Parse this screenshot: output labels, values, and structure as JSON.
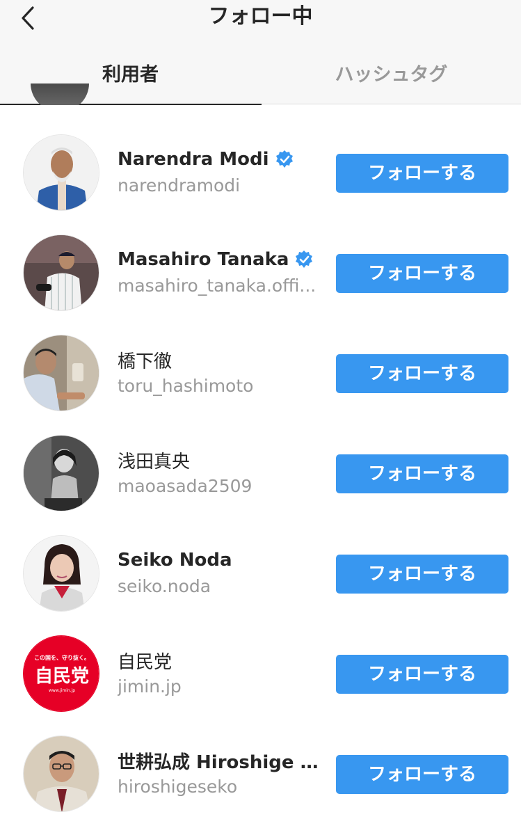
{
  "header": {
    "title": "フォロー中",
    "back_icon": "chevron-left-icon"
  },
  "tabs": [
    {
      "label": "利用者",
      "active": true
    },
    {
      "label": "ハッシュタグ",
      "active": false
    }
  ],
  "follow_label": "フォローする",
  "accounts": [
    {
      "name": "Narendra Modi",
      "handle": "narendramodi",
      "verified": true,
      "avatar": "narendra-modi-avatar"
    },
    {
      "name": "Masahiro Tanaka",
      "handle": "masahiro_tanaka.offi...",
      "verified": true,
      "avatar": "masahiro-tanaka-avatar"
    },
    {
      "name": "橋下徹",
      "handle": "toru_hashimoto",
      "verified": false,
      "avatar": "toru-hashimoto-avatar"
    },
    {
      "name": "浅田真央",
      "handle": "maoasada2509",
      "verified": false,
      "avatar": "mao-asada-avatar"
    },
    {
      "name": "Seiko Noda",
      "handle": "seiko.noda",
      "verified": false,
      "avatar": "seiko-noda-avatar"
    },
    {
      "name": "自民党",
      "handle": "jimin.jp",
      "verified": false,
      "avatar": "jimin-logo-avatar",
      "logo_text": {
        "top": "この国を、守り抜く。",
        "main": "自民党",
        "url": "www.jimin.jp"
      }
    },
    {
      "name": "世耕弘成 Hiroshige S...",
      "handle": "hiroshigeseko",
      "verified": false,
      "avatar": "hiroshige-seko-avatar"
    }
  ],
  "colors": {
    "follow_button": "#3897f0",
    "verified_badge": "#3897f0",
    "header_bg": "#f7f7f7",
    "jimin_red": "#e60026"
  }
}
